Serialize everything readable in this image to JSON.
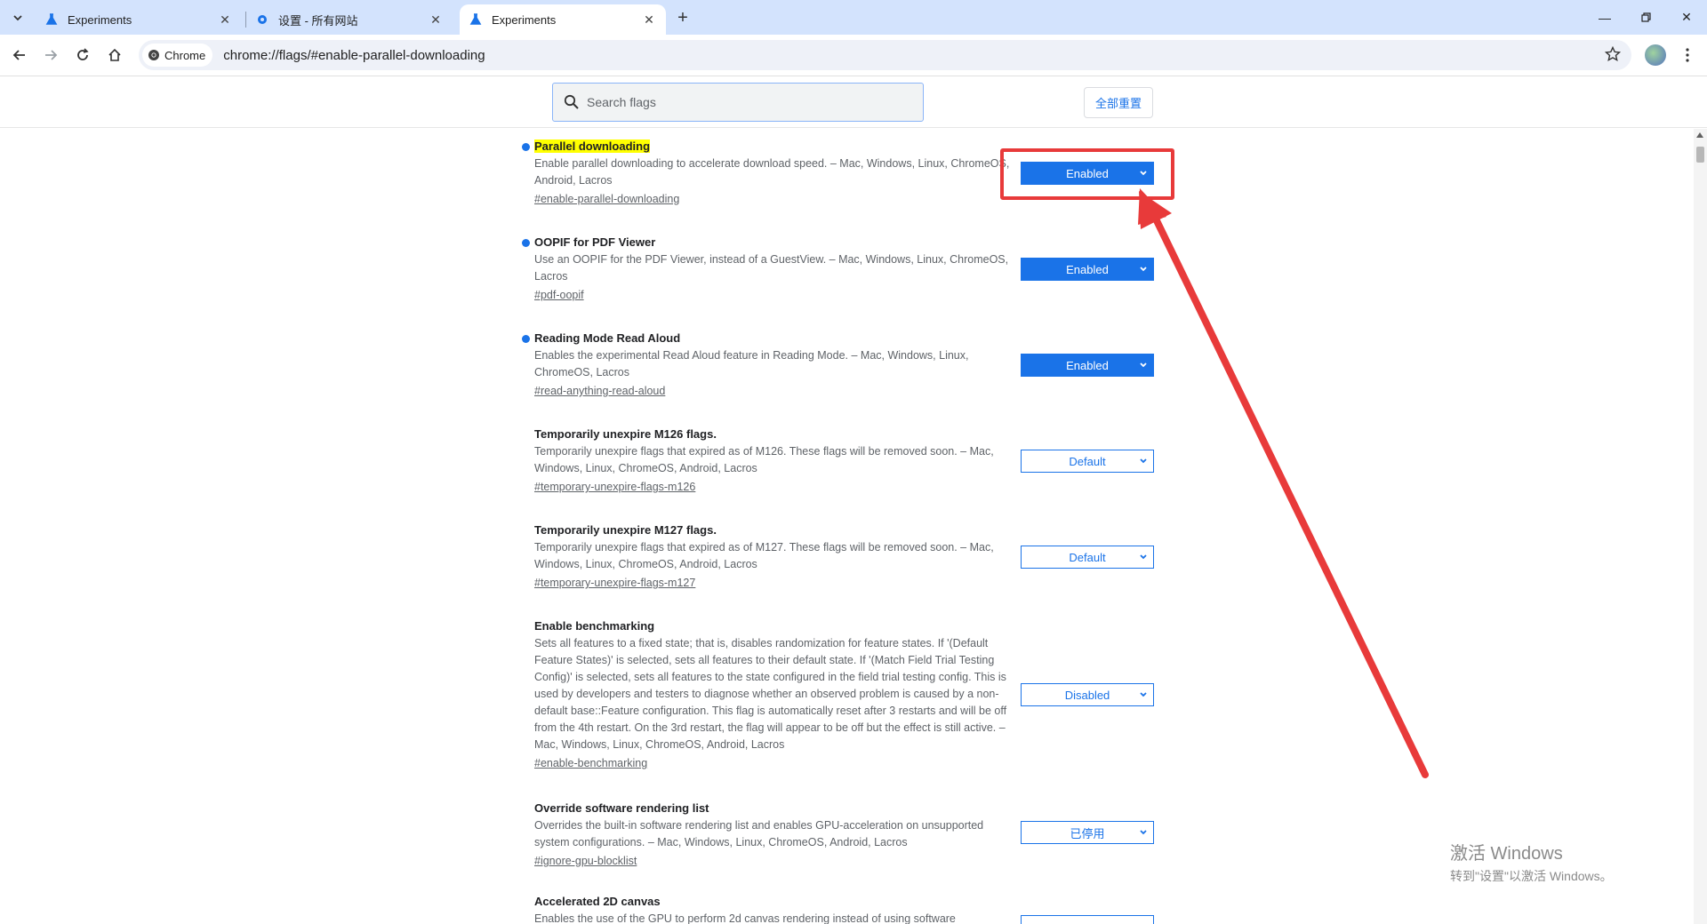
{
  "tabs": [
    {
      "title": "Experiments"
    },
    {
      "title": "设置 - 所有网站"
    },
    {
      "title": "Experiments"
    }
  ],
  "toolbar": {
    "chip_label": "Chrome",
    "url": "chrome://flags/#enable-parallel-downloading"
  },
  "header": {
    "search_placeholder": "Search flags",
    "reset_label": "全部重置"
  },
  "flags": [
    {
      "name": "Parallel downloading",
      "desc": "Enable parallel downloading to accelerate download speed. – Mac, Windows, Linux, ChromeOS, Android, Lacros",
      "link": "#enable-parallel-downloading",
      "value": "Enabled"
    },
    {
      "name": "OOPIF for PDF Viewer",
      "desc": "Use an OOPIF for the PDF Viewer, instead of a GuestView. – Mac, Windows, Linux, ChromeOS, Lacros",
      "link": "#pdf-oopif",
      "value": "Enabled"
    },
    {
      "name": "Reading Mode Read Aloud",
      "desc": "Enables the experimental Read Aloud feature in Reading Mode. – Mac, Windows, Linux, ChromeOS, Lacros",
      "link": "#read-anything-read-aloud",
      "value": "Enabled"
    },
    {
      "name": "Temporarily unexpire M126 flags.",
      "desc": "Temporarily unexpire flags that expired as of M126. These flags will be removed soon. – Mac, Windows, Linux, ChromeOS, Android, Lacros",
      "link": "#temporary-unexpire-flags-m126",
      "value": "Default"
    },
    {
      "name": "Temporarily unexpire M127 flags.",
      "desc": "Temporarily unexpire flags that expired as of M127. These flags will be removed soon. – Mac, Windows, Linux, ChromeOS, Android, Lacros",
      "link": "#temporary-unexpire-flags-m127",
      "value": "Default"
    },
    {
      "name": "Enable benchmarking",
      "desc": "Sets all features to a fixed state; that is, disables randomization for feature states. If '(Default Feature States)' is selected, sets all features to their default state. If '(Match Field Trial Testing Config)' is selected, sets all features to the state configured in the field trial testing config. This is used by developers and testers to diagnose whether an observed problem is caused by a non-default base::Feature configuration. This flag is automatically reset after 3 restarts and will be off from the 4th restart. On the 3rd restart, the flag will appear to be off but the effect is still active. – Mac, Windows, Linux, ChromeOS, Android, Lacros",
      "link": "#enable-benchmarking",
      "value": "Disabled"
    },
    {
      "name": "Override software rendering list",
      "desc": "Overrides the built-in software rendering list and enables GPU-acceleration on unsupported system configurations. – Mac, Windows, Linux, ChromeOS, Android, Lacros",
      "link": "#ignore-gpu-blocklist",
      "value": "已停用"
    },
    {
      "name": "Accelerated 2D canvas",
      "desc": "Enables the use of the GPU to perform 2d canvas rendering instead of using software",
      "link": "",
      "value": ""
    }
  ],
  "watermark": {
    "line1": "激活 Windows",
    "line2": "转到\"设置\"以激活 Windows。"
  },
  "colors": {
    "accent": "#1a73e8",
    "annotation_red": "#e83a3a",
    "highlight": "#ffff00",
    "tabstrip": "#d3e3fd"
  }
}
